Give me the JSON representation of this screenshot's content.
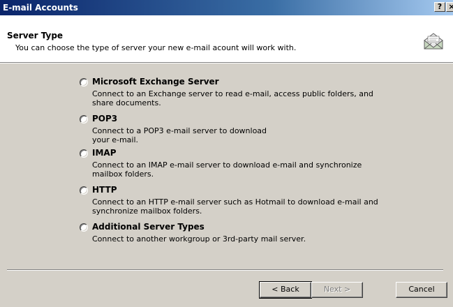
{
  "window": {
    "title": "E-mail Accounts",
    "help_label": "?",
    "close_label": "×"
  },
  "header": {
    "title": "Server Type",
    "subtitle": "You can choose the type of server your new e-mail acount will work with.",
    "icon": "mail-envelope-icon"
  },
  "options": [
    {
      "label": "Microsoft Exchange Server",
      "desc_lines": [
        "Connect to an Exchange server to read e-mail, access public folders, and",
        "share documents."
      ]
    },
    {
      "label": "POP3",
      "desc_lines": [
        "Connect to a POP3 e-mail server to download",
        "your e-mail."
      ]
    },
    {
      "label": "IMAP",
      "desc_lines": [
        "Connect to an IMAP e-mail server to download e-mail and synchronize",
        "mailbox folders."
      ]
    },
    {
      "label": "HTTP",
      "desc_lines": [
        "Connect to an HTTP e-mail server such as Hotmail to download e-mail and",
        "synchronize mailbox folders."
      ]
    },
    {
      "label": "Additional Server Types",
      "desc_lines": [
        "Connect to another workgroup or 3rd-party mail server."
      ]
    }
  ],
  "buttons": {
    "back": "< Back",
    "next": "Next >",
    "cancel": "Cancel"
  },
  "colors": {
    "title_bar_start": "#0a246a",
    "title_bar_end": "#a6caf0",
    "dialog_bg": "#d4d0c8"
  }
}
